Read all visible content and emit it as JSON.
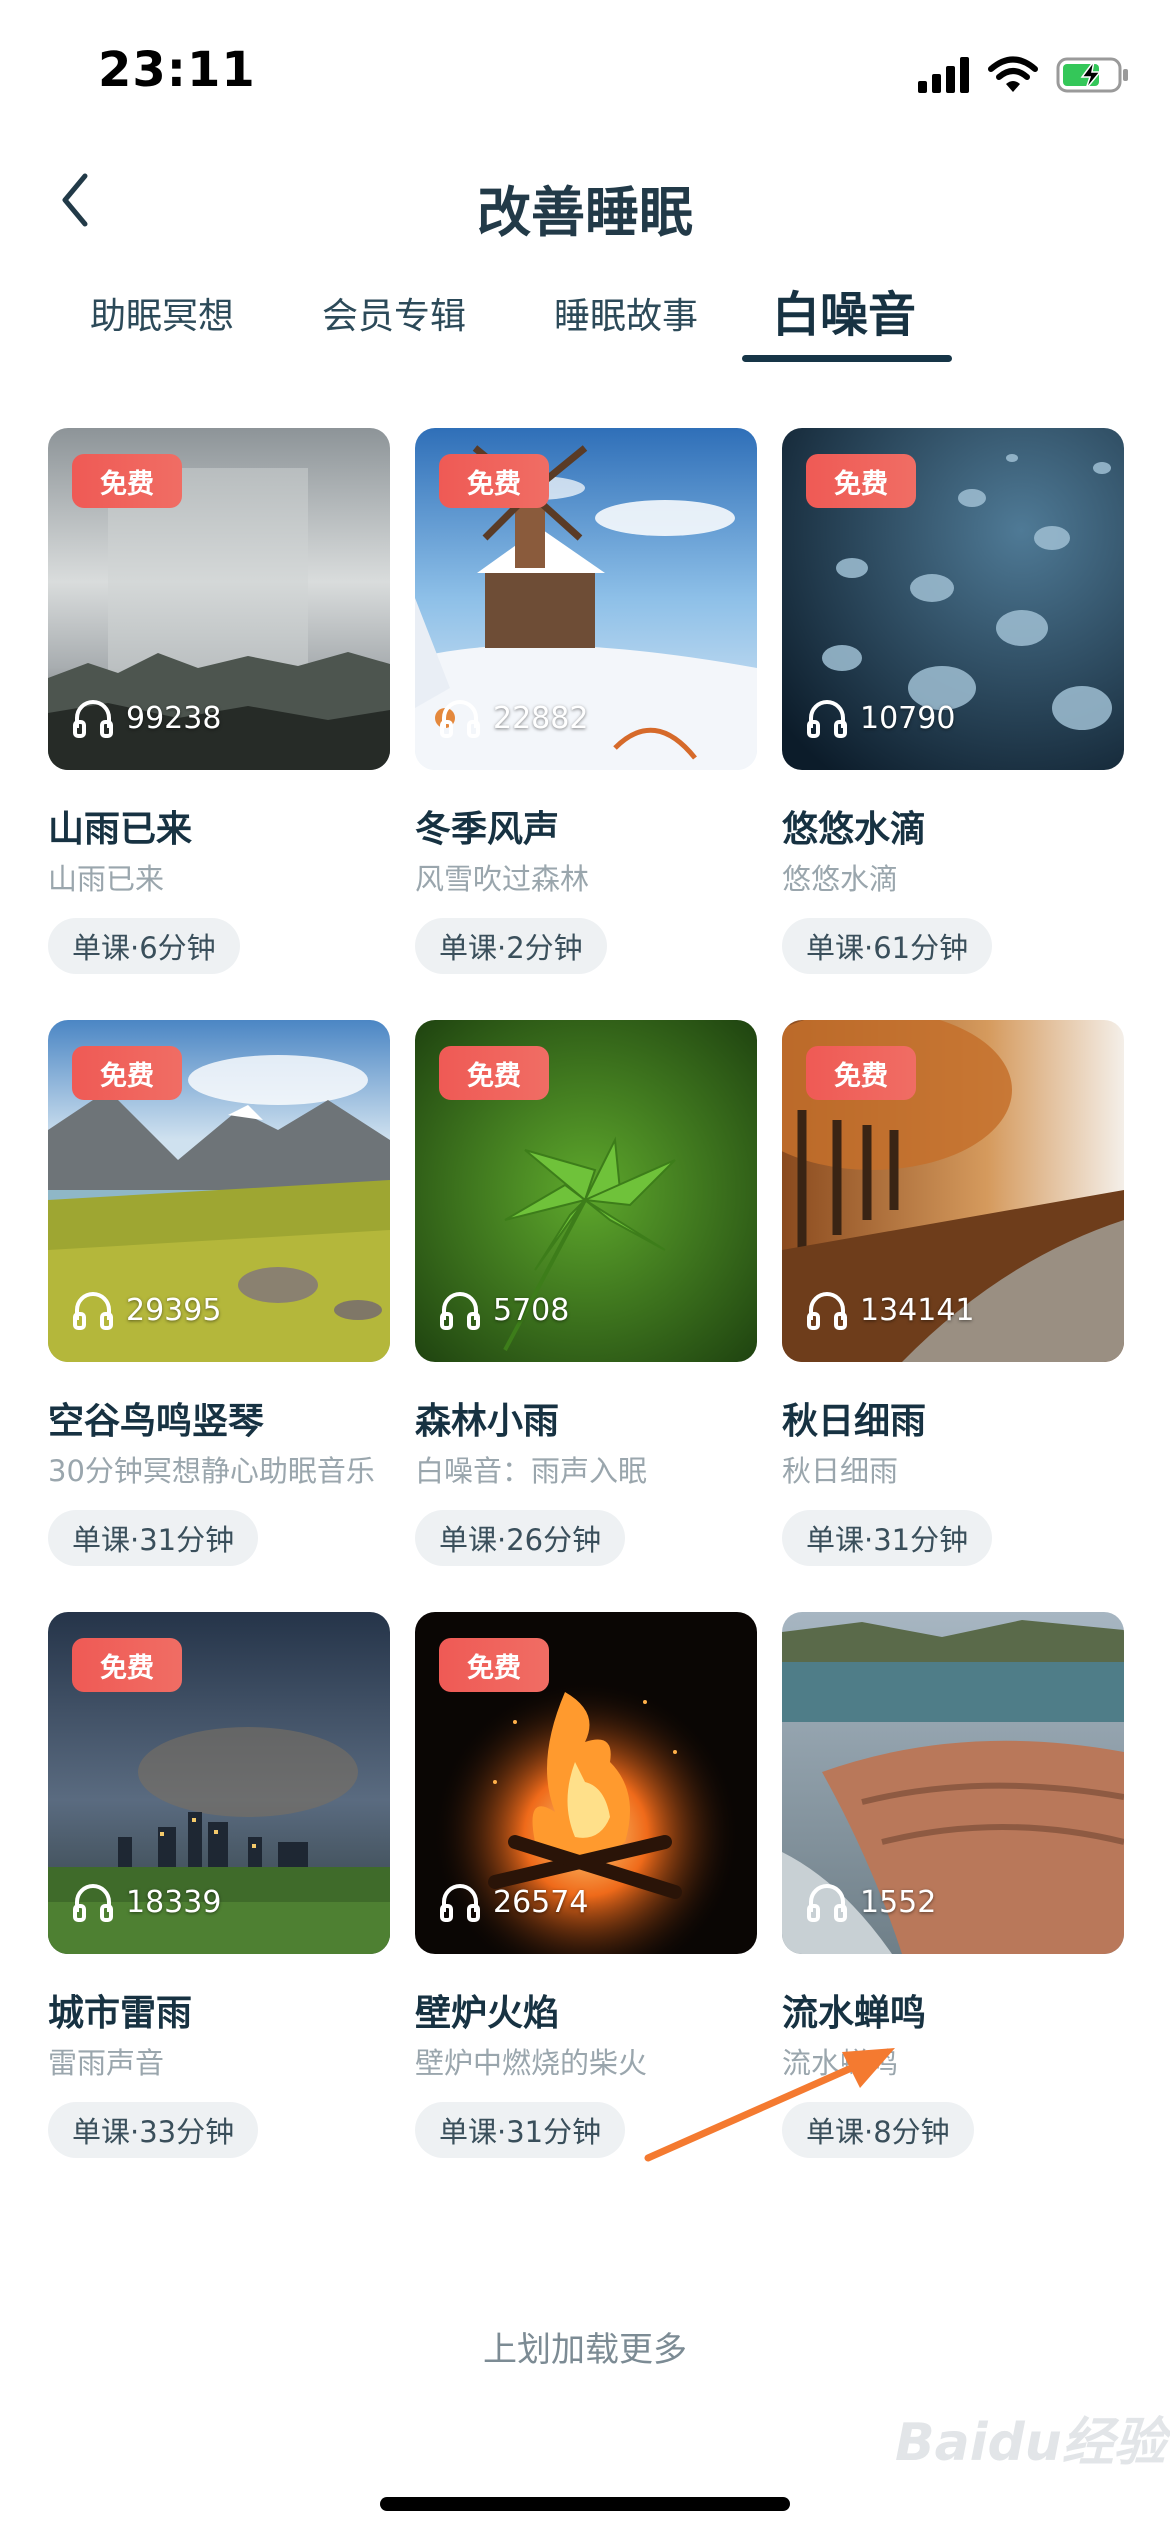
{
  "status_bar": {
    "time": "23:11"
  },
  "nav": {
    "title": "改善睡眠"
  },
  "tabs": [
    {
      "label": "助眠冥想"
    },
    {
      "label": "会员专辑"
    },
    {
      "label": "睡眠故事"
    },
    {
      "label": "白噪音",
      "active": true
    }
  ],
  "badge_label": "免费",
  "cards": [
    {
      "title": "山雨已来",
      "subtitle": "山雨已来",
      "plays": "99238",
      "meta": "单课·6分钟",
      "free": true,
      "scene": "mountain-rain"
    },
    {
      "title": "冬季风声",
      "subtitle": "风雪吹过森林",
      "plays": "22882",
      "meta": "单课·2分钟",
      "free": true,
      "scene": "winter-windmill"
    },
    {
      "title": "悠悠水滴",
      "subtitle": "悠悠水滴",
      "plays": "10790",
      "meta": "单课·61分钟",
      "free": true,
      "scene": "water-drops"
    },
    {
      "title": "空谷鸟鸣竖琴",
      "subtitle": "30分钟冥想静心助眠音乐",
      "plays": "29395",
      "meta": "单课·31分钟",
      "free": true,
      "scene": "mountain-valley"
    },
    {
      "title": "森林小雨",
      "subtitle": "白噪音：雨声入眠",
      "plays": "5708",
      "meta": "单课·26分钟",
      "free": true,
      "scene": "green-leaf"
    },
    {
      "title": "秋日细雨",
      "subtitle": "秋日细雨",
      "plays": "134141",
      "meta": "单课·31分钟",
      "free": true,
      "scene": "autumn-trees"
    },
    {
      "title": "城市雷雨",
      "subtitle": "雷雨声音",
      "plays": "18339",
      "meta": "单课·33分钟",
      "free": true,
      "scene": "city-storm"
    },
    {
      "title": "壁炉火焰",
      "subtitle": "壁炉中燃烧的柴火",
      "plays": "26574",
      "meta": "单课·31分钟",
      "free": true,
      "scene": "fireplace"
    },
    {
      "title": "流水蝉鸣",
      "subtitle": "流水蝉鸣",
      "plays": "1552",
      "meta": "单课·8分钟",
      "free": false,
      "scene": "river-rocks"
    }
  ],
  "footer": {
    "load_more": "上划加载更多"
  },
  "watermark": "Baidu经验",
  "colors": {
    "accent": "#173242",
    "badge": "#ef5a55",
    "annotation_arrow": "#f47a30"
  }
}
